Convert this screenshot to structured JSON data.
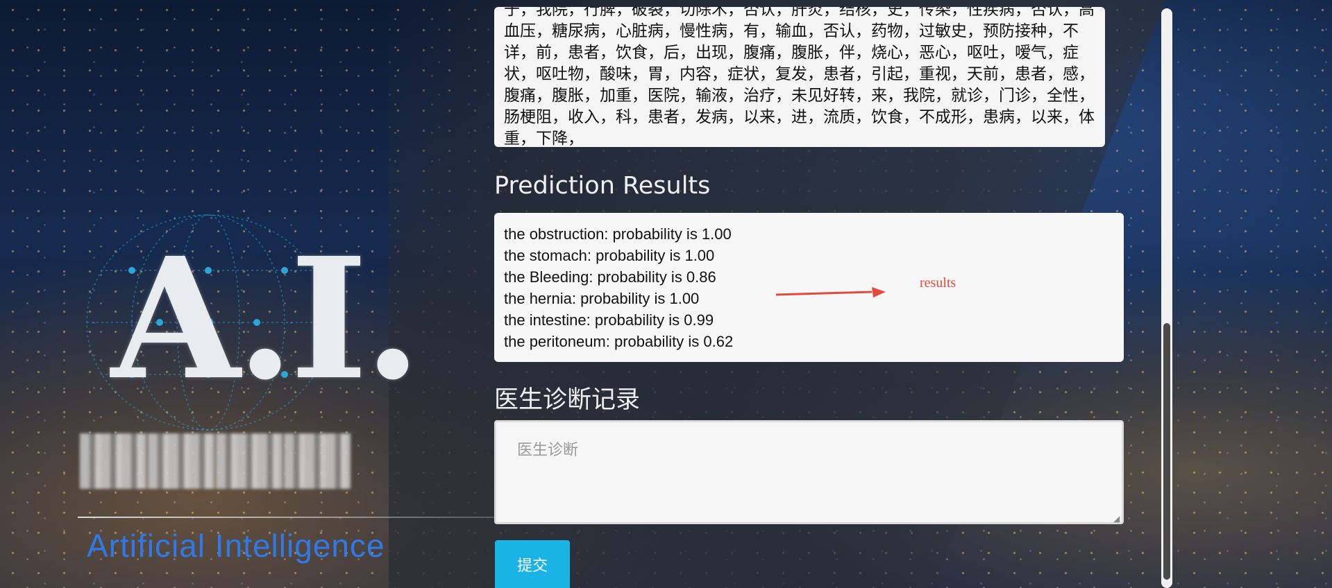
{
  "colors": {
    "accent_blue": "#1ab3e6",
    "brand_blue": "#2f7ae8",
    "annotation_red": "#e24a3c"
  },
  "brand": {
    "logo_letters": "A.I.",
    "subtitle": "Artificial  Intelligence"
  },
  "record": {
    "text": "于，我院，行脾，破裂，切除术，否认，肝炎，结核，史，传染，性疾病，否认，高血压，糖尿病，心脏病，慢性病，有，输血，否认，药物，过敏史，预防接种，不详，前，患者，饮食，后，出现，腹痛，腹胀，伴，烧心，恶心，呕吐，嗳气，症状，呕吐物，酸味，胃，内容，症状，复发，患者，引起，重视，天前，患者，感，腹痛，腹胀，加重，医院，输液，治疗，未见好转，来，我院，就诊，门诊，全性，肠梗阻，收入，科，患者，发病，以来，进，流质，饮食，不成形，患病，以来，体重，下降，"
  },
  "prediction": {
    "title": "Prediction Results",
    "results": [
      "the obstruction: probability is 1.00",
      "the stomach: probability is 1.00",
      "the Bleeding: probability is 0.86",
      "the hernia: probability is 1.00",
      "the intestine: probability is 0.99",
      "the peritoneum: probability is 0.62"
    ],
    "annotation": "results"
  },
  "doctor": {
    "title": "医生诊断记录",
    "placeholder": "医生诊断",
    "submit_label": "提交"
  }
}
